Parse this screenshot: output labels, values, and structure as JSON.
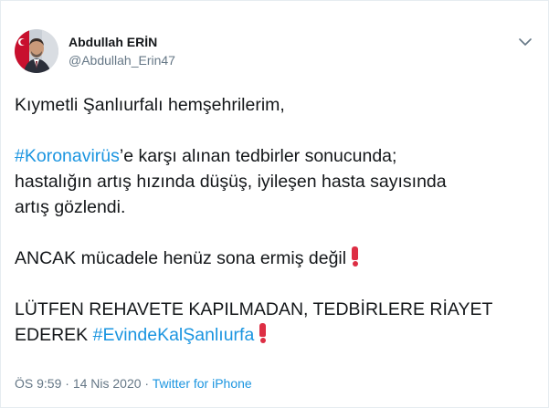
{
  "author": {
    "name": "Abdullah ERİN",
    "handle": "@Abdullah_Erin47"
  },
  "tweet": {
    "greeting": "Kıymetli Şanlıurfalı hemşehrilerim,",
    "p2_hashtag": "#Koronavirüs",
    "p2_line1_rest": "’e karşı alınan tedbirler sonucunda;",
    "p2_line2": "hastalığın artış hızında düşüş, iyileşen hasta sayısında",
    "p2_line3": "artış gözlendi.",
    "p3": "ANCAK mücadele henüz sona ermiş değil",
    "p4_line1": "LÜTFEN REHAVETE KAPILMADAN, TEDBİRLERE RİAYET",
    "p4_line2_prefix": "EDEREK ",
    "p4_hashtag": "#EvindeKalŞanlıurfa"
  },
  "meta": {
    "time": "ÖS 9:59",
    "separator1": " · ",
    "date": "14 Nis 2020",
    "separator2": " · ",
    "source": "Twitter for iPhone"
  },
  "icons": {
    "menu": "chevron-down-icon",
    "exclamation": "red-exclamation-emoji"
  },
  "colors": {
    "link": "#1b95e0",
    "secondary_text": "#657786",
    "primary_text": "#14171a",
    "emoji_red": "#dd2e44"
  }
}
